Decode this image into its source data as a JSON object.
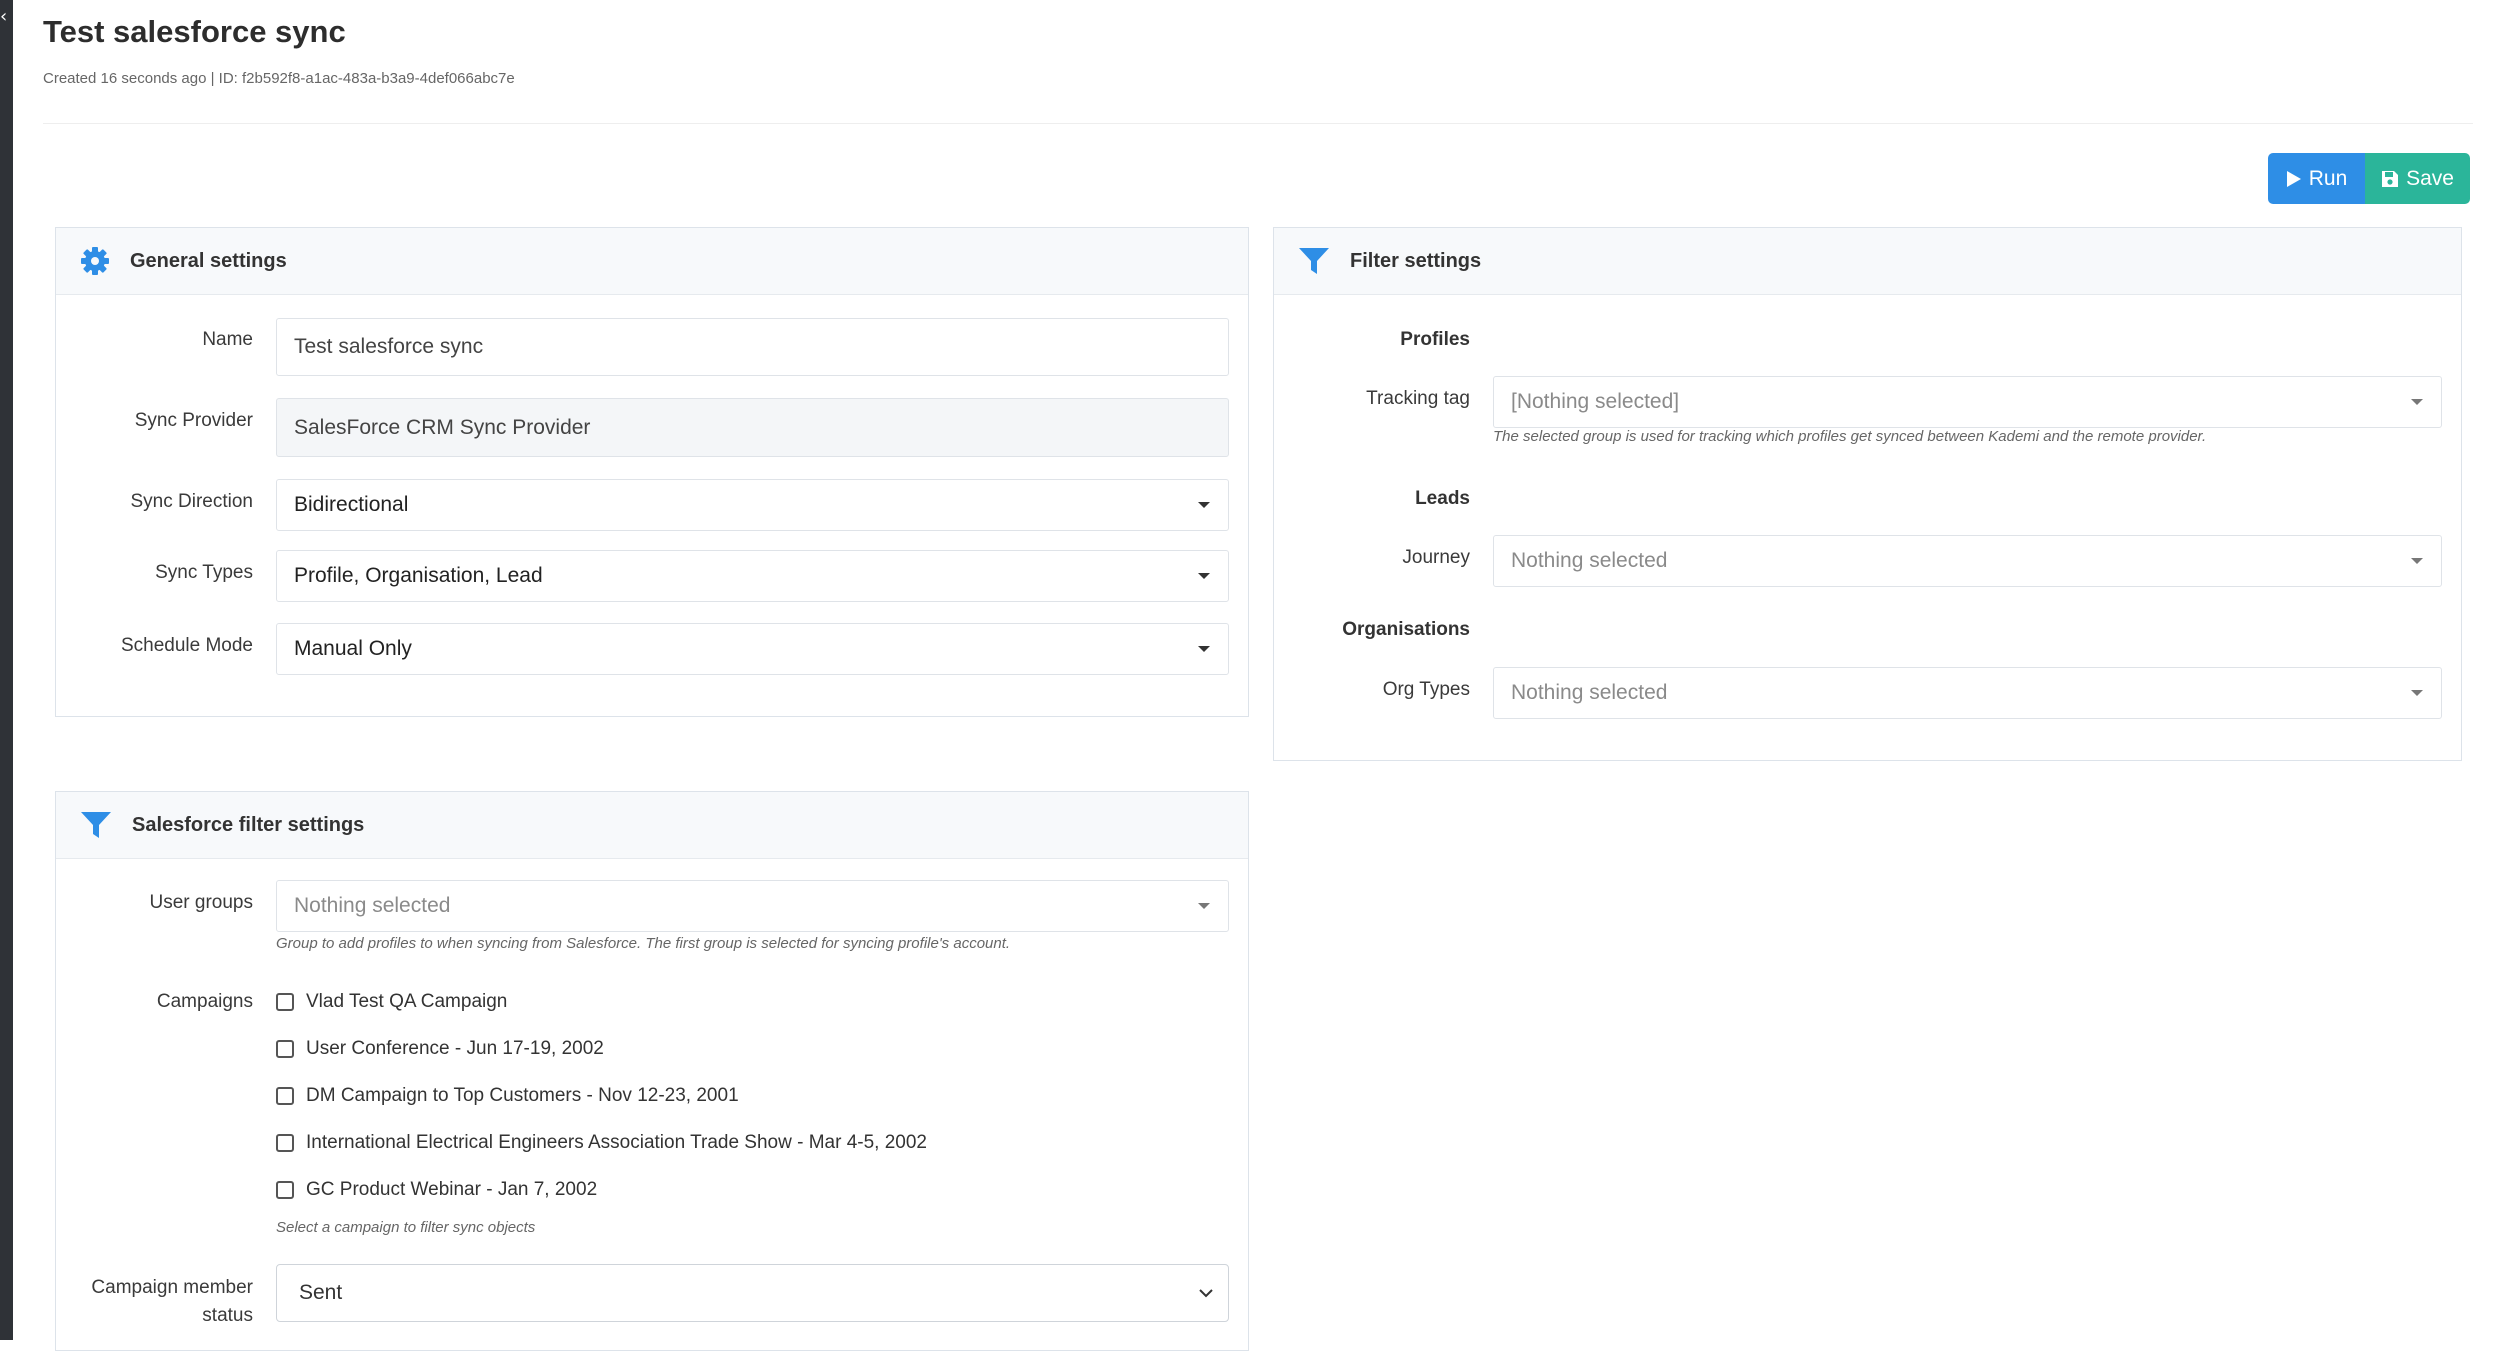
{
  "page": {
    "title": "Test salesforce sync",
    "meta": "Created 16 seconds ago | ID: f2b592f8-a1ac-483a-b3a9-4def066abc7e"
  },
  "sidebar": {
    "collapse_glyph": "‹"
  },
  "toolbar": {
    "run_label": "Run",
    "save_label": "Save",
    "run_color": "#2e8ee6",
    "save_color": "#2bb59a"
  },
  "general": {
    "title": "General settings",
    "icon": "gear-icon",
    "name_label": "Name",
    "name_value": "Test salesforce sync",
    "provider_label": "Sync Provider",
    "provider_value": "SalesForce CRM Sync Provider",
    "direction_label": "Sync Direction",
    "direction_value": "Bidirectional",
    "types_label": "Sync Types",
    "types_value": "Profile, Organisation, Lead",
    "schedule_label": "Schedule Mode",
    "schedule_value": "Manual Only"
  },
  "filter": {
    "title": "Filter settings",
    "icon": "filter-icon",
    "profiles_heading": "Profiles",
    "tracking_label": "Tracking tag",
    "tracking_value": "[Nothing selected]",
    "tracking_help": "The selected group is used for tracking which profiles get synced between Kademi and the remote provider.",
    "leads_heading": "Leads",
    "journey_label": "Journey",
    "journey_value": "Nothing selected",
    "orgs_heading": "Organisations",
    "orgtypes_label": "Org Types",
    "orgtypes_value": "Nothing selected"
  },
  "sf_filter": {
    "title": "Salesforce filter settings",
    "icon": "filter-icon",
    "usergroups_label": "User groups",
    "usergroups_value": "Nothing selected",
    "usergroups_help": "Group to add profiles to when syncing from Salesforce. The first group is selected for syncing profile's account.",
    "campaigns_label": "Campaigns",
    "campaigns": [
      {
        "label": "Vlad Test QA Campaign",
        "checked": false
      },
      {
        "label": "User Conference - Jun 17-19, 2002",
        "checked": false
      },
      {
        "label": "DM Campaign to Top Customers - Nov 12-23, 2001",
        "checked": false
      },
      {
        "label": "International Electrical Engineers Association Trade Show - Mar 4-5, 2002",
        "checked": false
      },
      {
        "label": "GC Product Webinar - Jan 7, 2002",
        "checked": false
      }
    ],
    "campaigns_help": "Select a campaign to filter sync objects",
    "member_status_label_line1": "Campaign member",
    "member_status_label_line2": "status",
    "member_status_value": "Sent"
  }
}
